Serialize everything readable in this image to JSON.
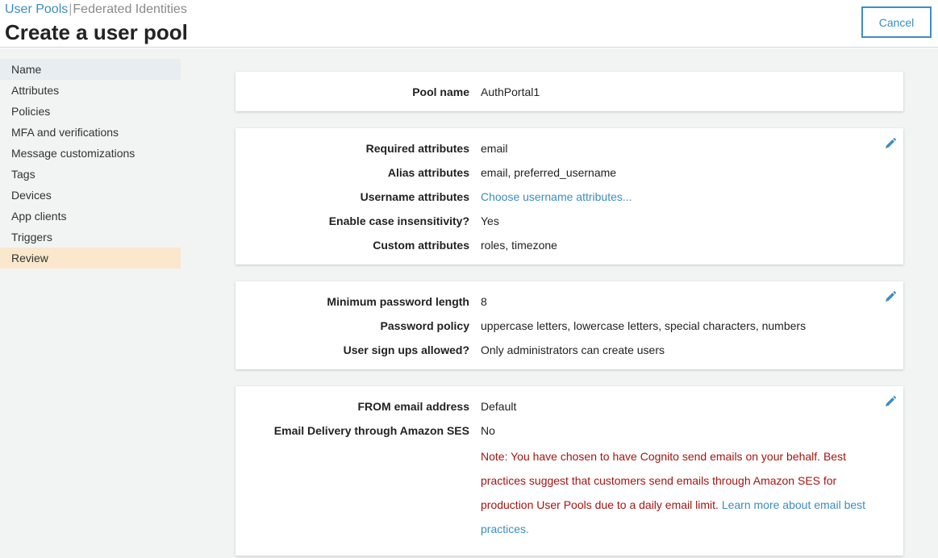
{
  "header": {
    "tabs": [
      {
        "label": "User Pools"
      },
      {
        "label": "Federated Identities"
      }
    ],
    "tab_separator": "|",
    "title": "Create a user pool",
    "cancel_label": "Cancel"
  },
  "sidebar": {
    "items": [
      {
        "label": "Name"
      },
      {
        "label": "Attributes"
      },
      {
        "label": "Policies"
      },
      {
        "label": "MFA and verifications"
      },
      {
        "label": "Message customizations"
      },
      {
        "label": "Tags"
      },
      {
        "label": "Devices"
      },
      {
        "label": "App clients"
      },
      {
        "label": "Triggers"
      },
      {
        "label": "Review"
      }
    ]
  },
  "sections": {
    "pool": {
      "pool_name_label": "Pool name",
      "pool_name_value": "AuthPortal1"
    },
    "attributes": {
      "required_label": "Required attributes",
      "required_value": "email",
      "alias_label": "Alias attributes",
      "alias_value": "email, preferred_username",
      "username_label": "Username attributes",
      "username_link": "Choose username attributes...",
      "case_label": "Enable case insensitivity?",
      "case_value": "Yes",
      "custom_label": "Custom attributes",
      "custom_value": "roles, timezone"
    },
    "policies": {
      "min_length_label": "Minimum password length",
      "min_length_value": "8",
      "policy_label": "Password policy",
      "policy_value": "uppercase letters, lowercase letters, special characters, numbers",
      "signup_label": "User sign ups allowed?",
      "signup_value": "Only administrators can create users"
    },
    "email": {
      "from_label": "FROM email address",
      "from_value": "Default",
      "ses_label": "Email Delivery through Amazon SES",
      "ses_value": "No",
      "note_text": "Note: You have chosen to have Cognito send emails on your behalf. Best practices suggest that customers send emails through Amazon SES for production User Pools due to a daily email limit.",
      "note_link": "Learn more about email best practices."
    }
  },
  "icons": {
    "edit": "pencil-icon"
  },
  "colors": {
    "link": "#3d8cc4",
    "note": "#a41512",
    "active_nav": "#e8edf2",
    "current_step": "#fae7cc",
    "background": "#f2f3f3"
  }
}
